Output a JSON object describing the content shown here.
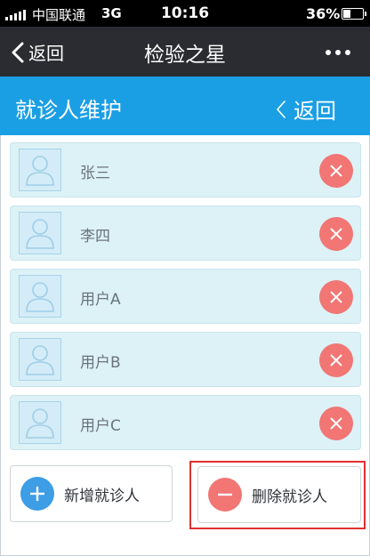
{
  "status_bar": {
    "carrier": "中国联通",
    "network": "3G",
    "time": "10:16",
    "battery": "36%",
    "battery_level": 0.36
  },
  "nav_bar": {
    "back_label": "返回",
    "title": "检验之星",
    "more_icon": "more-dots-icon"
  },
  "page_header": {
    "title": "就诊人维护",
    "back_label": "返回"
  },
  "patients": [
    {
      "name": "张三"
    },
    {
      "name": "李四"
    },
    {
      "name": "用户A"
    },
    {
      "name": "用户B"
    },
    {
      "name": "用户C"
    }
  ],
  "actions": {
    "add_label": "新增就诊人",
    "delete_label": "删除就诊人"
  },
  "colors": {
    "status_bar_bg": "#000000",
    "nav_bar_bg": "#2a2c31",
    "header_bg": "#1b9fe4",
    "row_bg": "#dcf2f7",
    "remove_red": "#f17674",
    "add_blue": "#3d9de5",
    "highlight_red": "#e13030"
  }
}
